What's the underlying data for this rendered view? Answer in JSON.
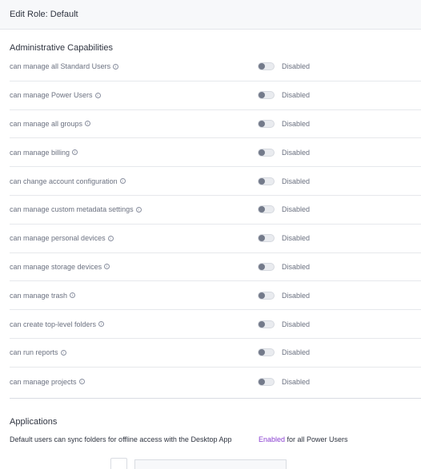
{
  "header": {
    "title": "Edit Role: Default"
  },
  "admin": {
    "title": "Administrative Capabilities",
    "rows": [
      {
        "label": "can manage all Standard Users",
        "status": "Disabled"
      },
      {
        "label": "can manage Power Users",
        "status": "Disabled"
      },
      {
        "label": "can manage all groups",
        "status": "Disabled"
      },
      {
        "label": "can manage billing",
        "status": "Disabled"
      },
      {
        "label": "can change account configuration",
        "status": "Disabled"
      },
      {
        "label": "can manage custom metadata settings",
        "status": "Disabled"
      },
      {
        "label": "can manage personal devices",
        "status": "Disabled"
      },
      {
        "label": "can manage storage devices",
        "status": "Disabled"
      },
      {
        "label": "can manage trash",
        "status": "Disabled"
      },
      {
        "label": "can create top-level folders",
        "status": "Disabled"
      },
      {
        "label": "can run reports",
        "status": "Disabled"
      },
      {
        "label": "can manage projects",
        "status": "Disabled"
      }
    ]
  },
  "applications": {
    "title": "Applications",
    "description": "Default users can sync folders for offline access with the Desktop App",
    "status_enabled": "Enabled",
    "status_suffix": " for all Power Users",
    "accent_color": "#8a3fd1"
  },
  "info_glyph": "i"
}
